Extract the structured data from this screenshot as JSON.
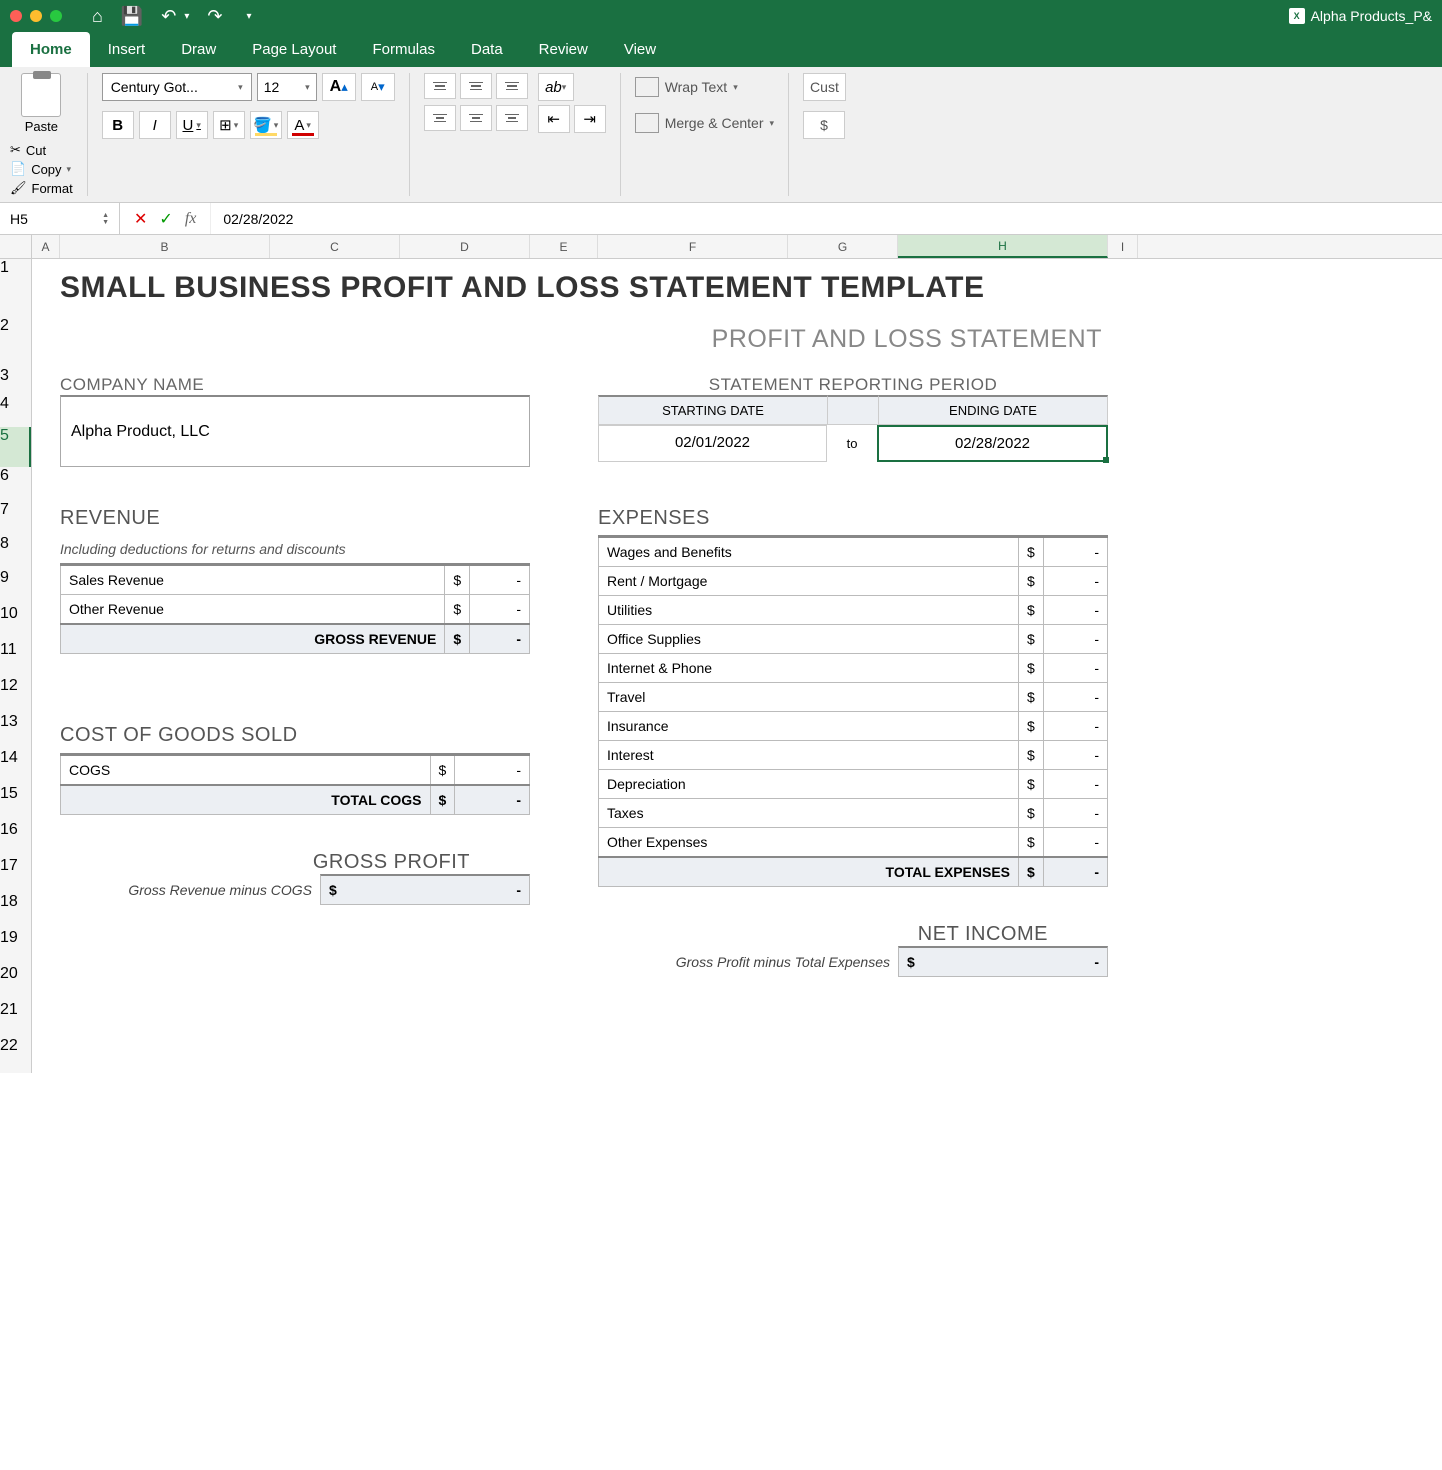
{
  "app": {
    "doc_title": "Alpha Products_P&"
  },
  "tabs": [
    "Home",
    "Insert",
    "Draw",
    "Page Layout",
    "Formulas",
    "Data",
    "Review",
    "View"
  ],
  "ribbon": {
    "paste": "Paste",
    "cut": "Cut",
    "copy": "Copy",
    "format": "Format",
    "font_name": "Century Got...",
    "font_size": "12",
    "wrap": "Wrap Text",
    "merge": "Merge & Center",
    "custom": "Cust"
  },
  "fbar": {
    "cell": "H5",
    "value": "02/28/2022"
  },
  "cols": [
    "A",
    "B",
    "C",
    "D",
    "E",
    "F",
    "G",
    "H",
    "I"
  ],
  "rows": [
    "1",
    "2",
    "3",
    "4",
    "5",
    "6",
    "7",
    "8",
    "9",
    "10",
    "11",
    "12",
    "13",
    "14",
    "15",
    "16",
    "17",
    "18",
    "19",
    "20",
    "21",
    "22"
  ],
  "sheet": {
    "title": "SMALL BUSINESS PROFIT AND LOSS STATEMENT TEMPLATE",
    "subtitle": "PROFIT AND LOSS STATEMENT",
    "company_label": "COMPANY NAME",
    "company_name": "Alpha Product, LLC",
    "period_label": "STATEMENT REPORTING PERIOD",
    "start_label": "STARTING DATE",
    "end_label": "ENDING DATE",
    "start_date": "02/01/2022",
    "to": "to",
    "end_date": "02/28/2022",
    "revenue": {
      "title": "REVENUE",
      "note": "Including deductions for returns and discounts",
      "rows": [
        {
          "label": "Sales Revenue",
          "val": "-"
        },
        {
          "label": "Other Revenue",
          "val": "-"
        }
      ],
      "total_label": "GROSS REVENUE",
      "total_val": "-"
    },
    "cogs": {
      "title": "COST OF GOODS SOLD",
      "rows": [
        {
          "label": "COGS",
          "val": "-"
        }
      ],
      "total_label": "TOTAL COGS",
      "total_val": "-"
    },
    "gp": {
      "title": "GROSS PROFIT",
      "note": "Gross Revenue minus COGS",
      "val": "-"
    },
    "expenses": {
      "title": "EXPENSES",
      "rows": [
        {
          "label": "Wages and Benefits",
          "val": "-"
        },
        {
          "label": "Rent / Mortgage",
          "val": "-"
        },
        {
          "label": "Utilities",
          "val": "-"
        },
        {
          "label": "Office Supplies",
          "val": "-"
        },
        {
          "label": "Internet & Phone",
          "val": "-"
        },
        {
          "label": "Travel",
          "val": "-"
        },
        {
          "label": "Insurance",
          "val": "-"
        },
        {
          "label": "Interest",
          "val": "-"
        },
        {
          "label": "Depreciation",
          "val": "-"
        },
        {
          "label": "Taxes",
          "val": "-"
        },
        {
          "label": "Other Expenses",
          "val": "-"
        }
      ],
      "total_label": "TOTAL EXPENSES",
      "total_val": "-"
    },
    "ni": {
      "title": "NET INCOME",
      "note": "Gross Profit minus Total Expenses",
      "val": "-"
    }
  }
}
